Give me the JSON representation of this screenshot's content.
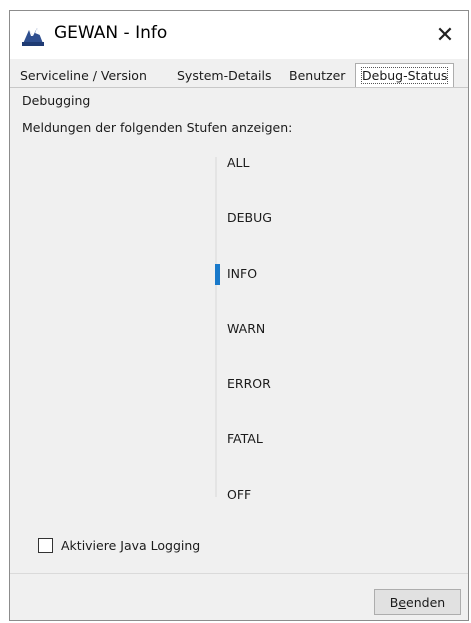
{
  "window": {
    "title": "GEWAN - Info",
    "close_glyph": "✕"
  },
  "tabs": [
    {
      "label": "Serviceline / Version",
      "active": false
    },
    {
      "label": "System-Details",
      "active": false
    },
    {
      "label": "Benutzer",
      "active": false
    },
    {
      "label": "Debug-Status",
      "active": true
    }
  ],
  "debug": {
    "group_label": "Debugging",
    "levels_label": "Meldungen der folgenden Stufen anzeigen:",
    "levels": [
      "ALL",
      "DEBUG",
      "INFO",
      "WARN",
      "ERROR",
      "FATAL",
      "OFF"
    ],
    "selected_level": "INFO",
    "accent_color": "#1979ca"
  },
  "java_logging": {
    "label": "Aktiviere Java Logging",
    "checked": false
  },
  "footer": {
    "button_prefix": "B",
    "button_mnemonic": "e",
    "button_suffix": "enden"
  }
}
